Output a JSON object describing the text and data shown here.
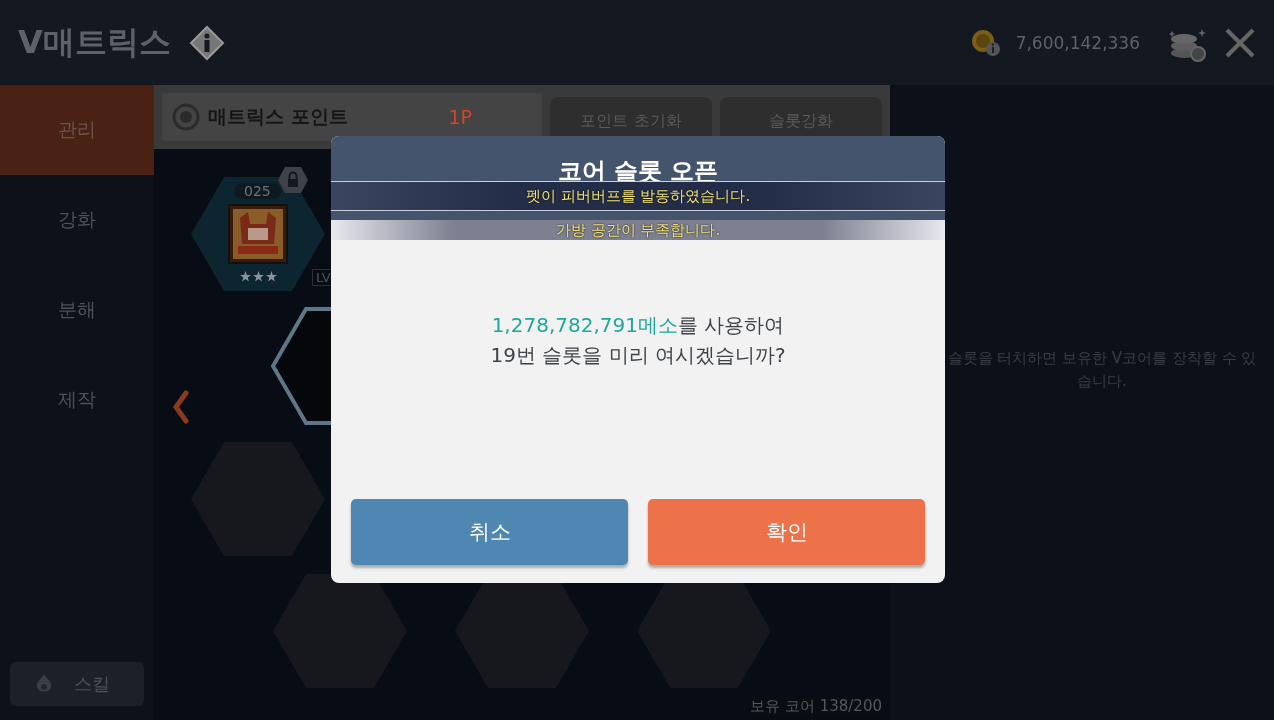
{
  "header": {
    "title": "V매트릭스",
    "meso": "7,600,142,336"
  },
  "sidebar": {
    "items": [
      {
        "label": "관리",
        "selected": true
      },
      {
        "label": "강화",
        "selected": false
      },
      {
        "label": "분해",
        "selected": false
      },
      {
        "label": "제작",
        "selected": false
      }
    ],
    "skill_button": "스킬"
  },
  "points_bar": {
    "label": "매트릭스 포인트",
    "value": "1P",
    "buttons": [
      "포인트 초기화",
      "슬롯강화"
    ]
  },
  "core": {
    "number": "025",
    "stars": 3,
    "locked": true,
    "level_label": "LV"
  },
  "core_count": "보유 코어 138/200",
  "hint": "슬롯을 터치하면 보유한 V코어를 장착할 수 있습니다.",
  "dialog": {
    "title": "코어 슬롯 오픈",
    "amount": "1,278,782,791메소",
    "message_rest": "를 사용하여",
    "message_line2": "19번 슬롯을 미리 여시겠습니까?",
    "cancel": "취소",
    "confirm": "확인"
  },
  "notices": [
    "펫이 피버버프를 발동하였습니다.",
    "가방 공간이 부족합니다."
  ]
}
